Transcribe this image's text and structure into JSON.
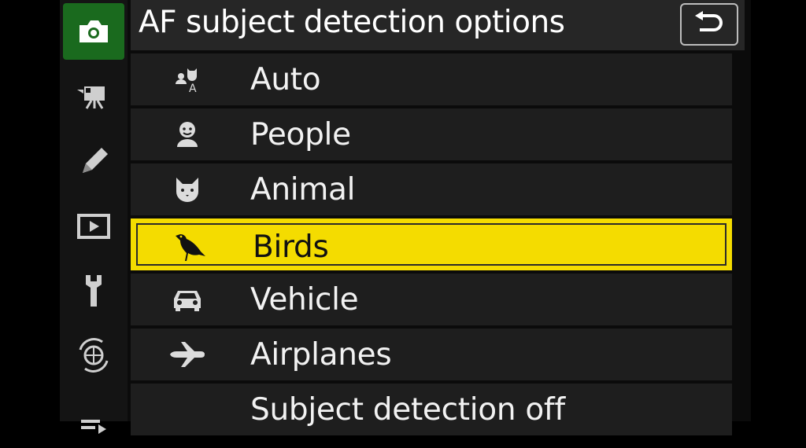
{
  "header": {
    "title": "AF subject detection options",
    "back_icon": "return-icon"
  },
  "sidebar": {
    "items": [
      {
        "icon": "camera-icon",
        "active": true
      },
      {
        "icon": "movie-camera-icon",
        "active": false
      },
      {
        "icon": "pencil-icon",
        "active": false
      },
      {
        "icon": "playback-icon",
        "active": false
      },
      {
        "icon": "wrench-icon",
        "active": false
      },
      {
        "icon": "network-icon",
        "active": false
      },
      {
        "icon": "my-menu-icon",
        "active": false
      }
    ]
  },
  "options": [
    {
      "label": "Auto",
      "icon": "auto-subject-icon",
      "selected": false
    },
    {
      "label": "People",
      "icon": "person-icon",
      "selected": false
    },
    {
      "label": "Animal",
      "icon": "animal-icon",
      "selected": false
    },
    {
      "label": "Birds",
      "icon": "bird-icon",
      "selected": true
    },
    {
      "label": "Vehicle",
      "icon": "car-icon",
      "selected": false
    },
    {
      "label": "Airplanes",
      "icon": "airplane-icon",
      "selected": false
    },
    {
      "label": "Subject detection off",
      "icon": "",
      "selected": false
    }
  ],
  "colors": {
    "highlight": "#f4dc00",
    "active_tab": "#1a6a1e",
    "row_bg": "#1e1e1e",
    "header_bg": "#262626"
  }
}
